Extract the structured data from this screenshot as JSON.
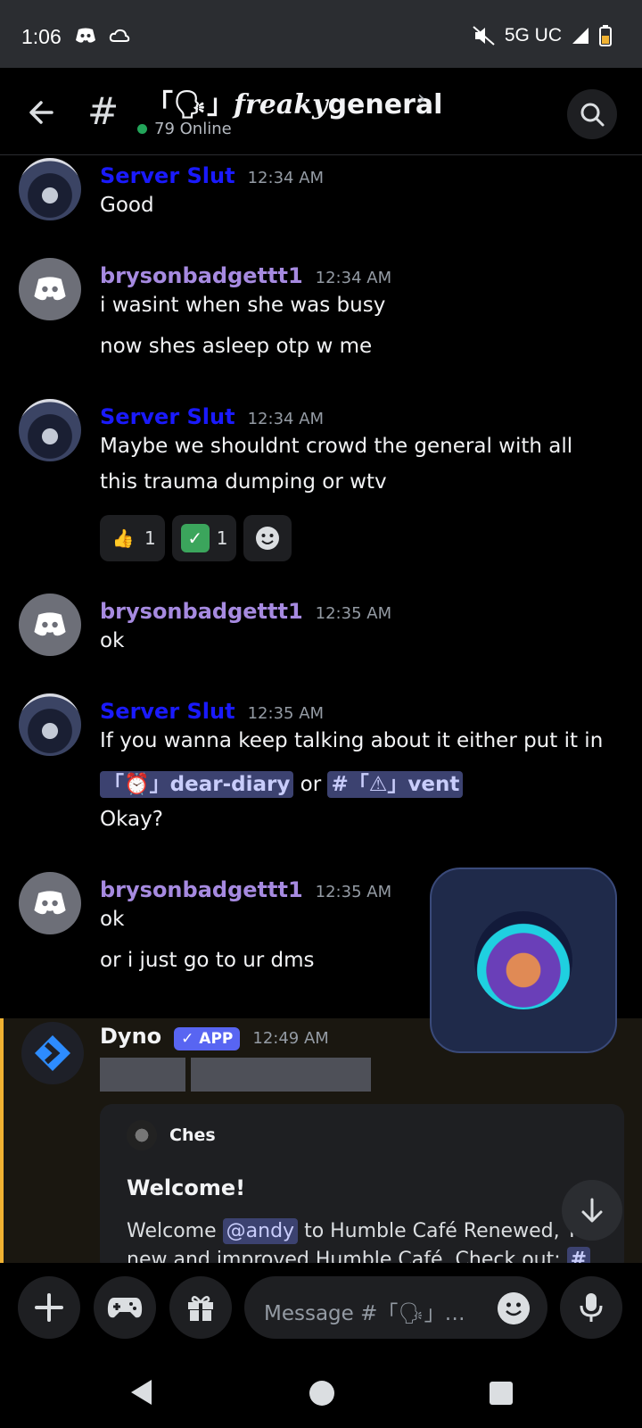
{
  "status_bar": {
    "time": "1:06",
    "network": "5G UC"
  },
  "header": {
    "channel_prefix": "「🗣」",
    "channel_styled": "freaky",
    "channel_word": "general",
    "online": "79 Online"
  },
  "messages": [
    {
      "author": "Server Slut",
      "time": "12:34 AM",
      "lines": [
        "Good"
      ]
    },
    {
      "author": "brysonbadgettt1",
      "time": "12:34 AM",
      "lines": [
        "i wasint when she was busy",
        "now shes asleep otp w me"
      ]
    },
    {
      "author": "Server Slut",
      "time": "12:34 AM",
      "lines": [
        "Maybe we shouldnt crowd the general with all",
        "this trauma dumping or wtv"
      ],
      "reactions": [
        {
          "emoji": "👍",
          "count": "1"
        },
        {
          "emoji": "✓",
          "count": "1"
        }
      ]
    },
    {
      "author": "brysonbadgettt1",
      "time": "12:35 AM",
      "lines": [
        "ok"
      ]
    },
    {
      "author": "Server Slut",
      "time": "12:35 AM",
      "lines": [
        "If you wanna keep talking about it either put it in",
        "Okay?"
      ],
      "mention1": "「⏰」dear-diary",
      "between": "or",
      "mention2": "#「⚠」vent"
    },
    {
      "author": "brysonbadgettt1",
      "time": "12:35 AM",
      "lines": [
        "ok",
        "or i just go to ur dms"
      ]
    }
  ],
  "dyno": {
    "author": "Dyno",
    "badge": "✓ APP",
    "time": "12:49 AM",
    "embed": {
      "author": "Ches",
      "title": "Welcome!",
      "welcome": "Welcome",
      "mention": "@andy",
      "line1_rest": "to Humble Café Renewed, Th",
      "line2": "new and improved Humble Café. Check out:",
      "line2_hash": "#"
    }
  },
  "input": {
    "placeholder": "Message #「🗣」…"
  }
}
